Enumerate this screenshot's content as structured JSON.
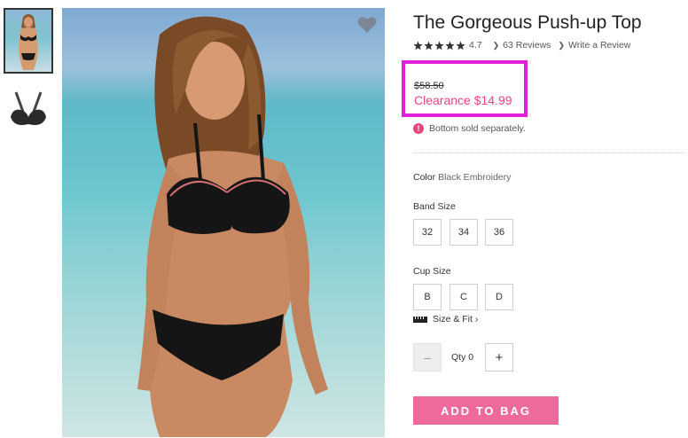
{
  "product": {
    "title": "The Gorgeous Push-up Top",
    "rating_value": "4.7",
    "rating_stars": 5,
    "reviews_link": "63 Reviews",
    "write_review_link": "Write a Review"
  },
  "price": {
    "original": "$58.50",
    "sale": "Clearance $14.99",
    "highlight_color": "#e020d6",
    "sale_color": "#e8457c"
  },
  "note": {
    "icon": "exclamation-icon",
    "text": "Bottom sold separately."
  },
  "color": {
    "label": "Color",
    "value": "Black Embroidery"
  },
  "band_size": {
    "label": "Band Size",
    "options": [
      "32",
      "34",
      "36"
    ]
  },
  "cup_size": {
    "label": "Cup Size",
    "options": [
      "B",
      "C",
      "D"
    ]
  },
  "size_fit": {
    "icon": "ruler-icon",
    "label": "Size & Fit ›"
  },
  "quantity": {
    "minus_label": "–",
    "label": "Qty 0",
    "plus_label": "+"
  },
  "add_to_bag": {
    "label": "ADD TO BAG",
    "color": "#ee6a9c"
  },
  "images": {
    "favorite_icon": "heart-icon"
  }
}
